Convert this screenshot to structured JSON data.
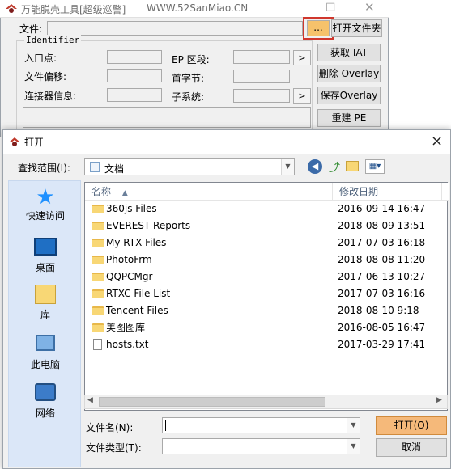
{
  "bgwindow": {
    "title": "万能脱壳工具[超级巡警]",
    "url": "WWW.52SanMiao.CN",
    "file_label": "文件:",
    "browse_label": "...",
    "open_folder_label": "打开文件夹",
    "group_label": "Identifier",
    "entry_label": "入口点:",
    "offset_label": "文件偏移:",
    "linker_label": "连接器信息:",
    "ep_section_label": "EP  区段:",
    "first_byte_label": "首字节:",
    "subsystem_label": "子系统:",
    "get_iat_label": "获取 IAT",
    "delete_overlay_label": "删除 Overlay",
    "save_overlay_label": "保存Overlay",
    "rebuild_pe_label": "重建 PE",
    "arrow1": ">",
    "arrow2": ">"
  },
  "dialog": {
    "title": "打开",
    "lookin_label": "查找范围(I):",
    "lookin_value": "文档",
    "close_glyph": "×",
    "places": [
      {
        "label": "快速访问",
        "icon": "star-icon"
      },
      {
        "label": "桌面",
        "icon": "desktop-icon"
      },
      {
        "label": "库",
        "icon": "library-icon"
      },
      {
        "label": "此电脑",
        "icon": "computer-icon"
      },
      {
        "label": "网络",
        "icon": "network-icon"
      }
    ],
    "col_name": "名称",
    "col_date": "修改日期",
    "files": [
      {
        "name": "360js Files",
        "date": "2016-09-14 16:47",
        "type": "folder"
      },
      {
        "name": "EVEREST Reports",
        "date": "2018-08-09 13:51",
        "type": "folder"
      },
      {
        "name": "My RTX Files",
        "date": "2017-07-03 16:18",
        "type": "folder"
      },
      {
        "name": "PhotoFrm",
        "date": "2018-08-08 11:20",
        "type": "folder"
      },
      {
        "name": "QQPCMgr",
        "date": "2017-06-13 10:27",
        "type": "folder"
      },
      {
        "name": "RTXC File List",
        "date": "2017-07-03 16:16",
        "type": "folder"
      },
      {
        "name": "Tencent Files",
        "date": "2018-08-10 9:18",
        "type": "folder"
      },
      {
        "name": "美图图库",
        "date": "2016-08-05 16:47",
        "type": "folder"
      },
      {
        "name": "hosts.txt",
        "date": "2017-03-29 17:41",
        "type": "file"
      }
    ],
    "filename_label": "文件名(N):",
    "filename_value": "",
    "filetype_label": "文件类型(T):",
    "filetype_value": "",
    "open_label": "打开(O)",
    "cancel_label": "取消"
  }
}
